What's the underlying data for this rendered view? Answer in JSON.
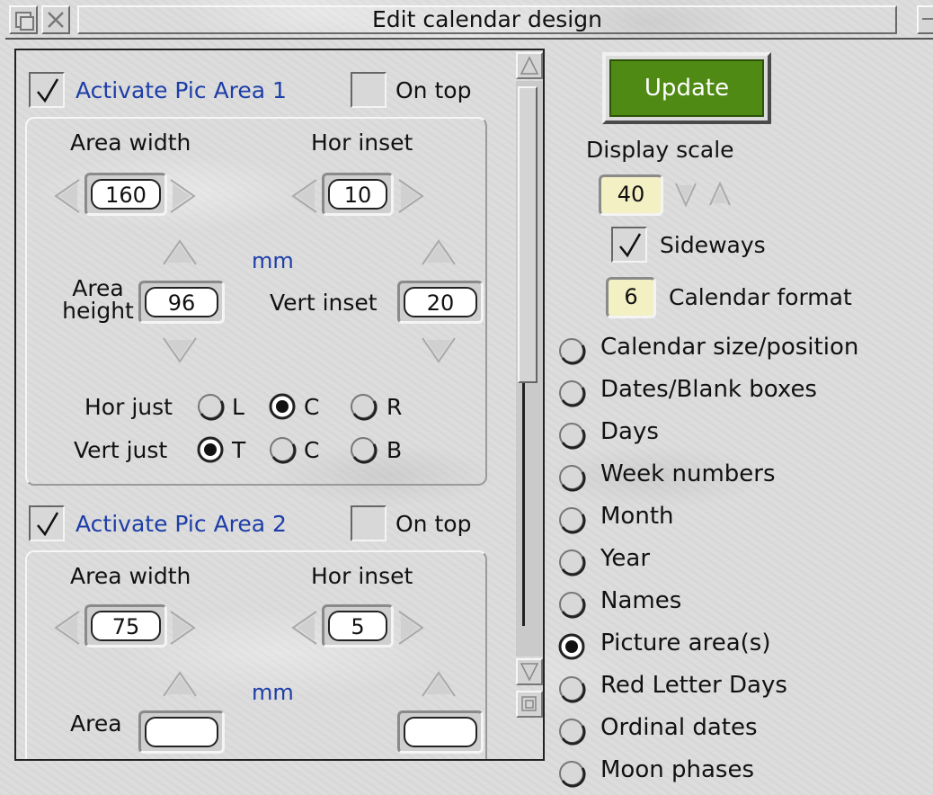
{
  "window": {
    "title": "Edit calendar design"
  },
  "left": {
    "areas": [
      {
        "activate_label": "Activate Pic Area 1",
        "activate_checked": true,
        "on_top_label": "On top",
        "on_top_checked": false,
        "area_width_label": "Area width",
        "area_width": "160",
        "hor_inset_label": "Hor inset",
        "hor_inset": "10",
        "unit": "mm",
        "area_height_label_1": "Area",
        "area_height_label_2": "height",
        "area_height": "96",
        "vert_inset_label": "Vert inset",
        "vert_inset": "20",
        "hor_just_label": "Hor just",
        "hor_just_options": [
          "L",
          "C",
          "R"
        ],
        "hor_just_selected": "C",
        "vert_just_label": "Vert just",
        "vert_just_options": [
          "T",
          "C",
          "B"
        ],
        "vert_just_selected": "T"
      },
      {
        "activate_label": "Activate Pic Area 2",
        "activate_checked": true,
        "on_top_label": "On top",
        "on_top_checked": false,
        "area_width_label": "Area width",
        "area_width": "75",
        "hor_inset_label": "Hor inset",
        "hor_inset": "5",
        "unit": "mm",
        "area_height_label_1": "Area"
      }
    ]
  },
  "right": {
    "update_label": "Update",
    "display_scale_label": "Display scale",
    "display_scale": "40",
    "sideways_label": "Sideways",
    "sideways_checked": true,
    "calendar_format": "6",
    "calendar_format_label": "Calendar format",
    "sections": [
      {
        "label": "Calendar size/position",
        "selected": false
      },
      {
        "label": "Dates/Blank boxes",
        "selected": false
      },
      {
        "label": "Days",
        "selected": false
      },
      {
        "label": "Week numbers",
        "selected": false
      },
      {
        "label": "Month",
        "selected": false
      },
      {
        "label": "Year",
        "selected": false
      },
      {
        "label": "Names",
        "selected": false
      },
      {
        "label": "Picture area(s)",
        "selected": true
      },
      {
        "label": "Red Letter Days",
        "selected": false
      },
      {
        "label": "Ordinal dates",
        "selected": false
      },
      {
        "label": "Moon phases",
        "selected": false
      }
    ]
  },
  "icons": {
    "back": "window-back-icon",
    "close": "window-close-icon",
    "toggle": "toggle-size-icon",
    "arrow_left": "arrow-left-icon",
    "arrow_right": "arrow-right-icon",
    "arrow_up": "arrow-up-icon",
    "arrow_down": "arrow-down-icon"
  },
  "colors": {
    "update_button": "#4f8a14",
    "label_blue": "#1d3ea8",
    "yellow_field": "#f3f0c4"
  }
}
